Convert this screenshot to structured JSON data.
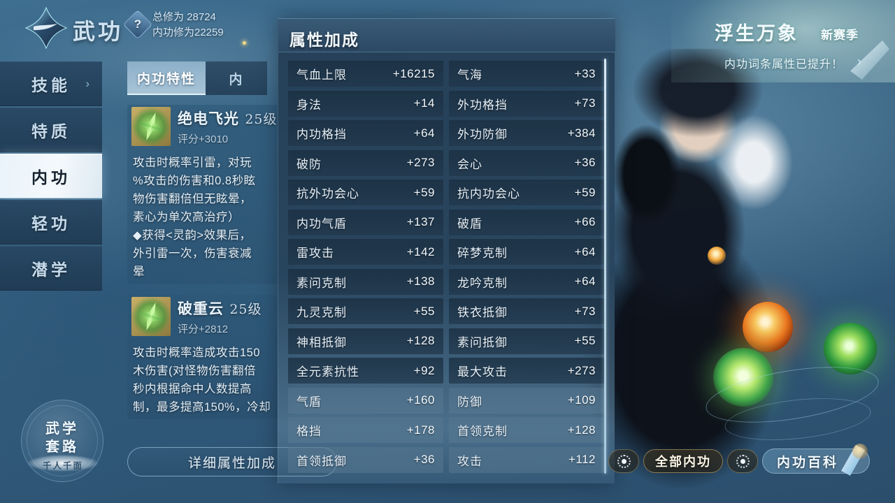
{
  "header": {
    "emblem_icon": "diamond-emblem-icon",
    "title": "武功",
    "help_icon": "question-mark-icon",
    "total_cultivation": "总修为 28724",
    "inner_cultivation": "内功修为22259"
  },
  "season_banner": {
    "title": "浮生万象",
    "badge": "新赛季",
    "subtitle": "内功词条属性已提升！",
    "arrow_icon": "chevron-right-icon",
    "feather_icon": "feather-icon"
  },
  "sidebar": {
    "items": [
      {
        "label": "技能",
        "active": false,
        "chevron": "›"
      },
      {
        "label": "特质",
        "active": false,
        "chevron": ""
      },
      {
        "label": "内功",
        "active": true,
        "chevron": ""
      },
      {
        "label": "轻功",
        "active": false,
        "chevron": ""
      },
      {
        "label": "潜学",
        "active": false,
        "chevron": ""
      }
    ]
  },
  "skill_panel": {
    "tabs": [
      {
        "label": "内功特性",
        "active": true
      },
      {
        "label": "内",
        "active": false
      }
    ],
    "cards": [
      {
        "icon": "wood-skill-icon",
        "name": "绝电飞光",
        "level": "25级",
        "score": "评分+3010",
        "description_lines": [
          "攻击时概率引雷，对玩",
          "%攻击的伤害和0.8秒眩",
          "物伤害翻倍但无眩晕，",
          "素心为单次高治疗）",
          "◆获得<灵韵>效果后，",
          "外引雷一次，伤害衰减",
          "晕"
        ]
      },
      {
        "icon": "wood-skill-icon",
        "name": "破重云",
        "level": "25级",
        "score": "评分+2812",
        "description_lines": [
          "攻击时概率造成攻击150",
          "木伤害(对怪物伤害翻倍",
          "秒内根据命中人数提高",
          "制，最多提高150%，冷却"
        ]
      }
    ],
    "detail_button": "详细属性加成"
  },
  "attribute_panel": {
    "title": "属性加成",
    "scrollbar": "vertical-scrollbar",
    "rows": [
      {
        "name": "气血上限",
        "value": "+16215",
        "dim": false
      },
      {
        "name": "气海",
        "value": "+33",
        "dim": false
      },
      {
        "name": "身法",
        "value": "+14",
        "dim": false
      },
      {
        "name": "外功格挡",
        "value": "+73",
        "dim": false
      },
      {
        "name": "内功格挡",
        "value": "+64",
        "dim": false
      },
      {
        "name": "外功防御",
        "value": "+384",
        "dim": false
      },
      {
        "name": "破防",
        "value": "+273",
        "dim": false
      },
      {
        "name": "会心",
        "value": "+36",
        "dim": false
      },
      {
        "name": "抗外功会心",
        "value": "+59",
        "dim": false
      },
      {
        "name": "抗内功会心",
        "value": "+59",
        "dim": false
      },
      {
        "name": "内功气盾",
        "value": "+137",
        "dim": false
      },
      {
        "name": "破盾",
        "value": "+66",
        "dim": false
      },
      {
        "name": "雷攻击",
        "value": "+142",
        "dim": false
      },
      {
        "name": "碎梦克制",
        "value": "+64",
        "dim": false
      },
      {
        "name": "素问克制",
        "value": "+138",
        "dim": false
      },
      {
        "name": "龙吟克制",
        "value": "+64",
        "dim": false
      },
      {
        "name": "九灵克制",
        "value": "+55",
        "dim": false
      },
      {
        "name": "铁衣抵御",
        "value": "+73",
        "dim": false
      },
      {
        "name": "神相抵御",
        "value": "+128",
        "dim": false
      },
      {
        "name": "素问抵御",
        "value": "+55",
        "dim": false
      },
      {
        "name": "全元素抗性",
        "value": "+92",
        "dim": false
      },
      {
        "name": "最大攻击",
        "value": "+273",
        "dim": false
      },
      {
        "name": "气盾",
        "value": "+160",
        "dim": true
      },
      {
        "name": "防御",
        "value": "+109",
        "dim": true
      },
      {
        "name": "格挡",
        "value": "+178",
        "dim": true
      },
      {
        "name": "首领克制",
        "value": "+128",
        "dim": true
      },
      {
        "name": "首领抵御",
        "value": "+36",
        "dim": true
      },
      {
        "name": "攻击",
        "value": "+112",
        "dim": true
      }
    ]
  },
  "bottom_left_badge": {
    "line1": "武学",
    "line2": "套路",
    "subtitle": "千人千面"
  },
  "bottom_bar": {
    "toggle_icon_left": "target-circle-icon",
    "all_neigong_label": "全部内功",
    "toggle_icon_right": "target-circle-icon",
    "encyclopedia_label": "内功百科",
    "scroll_icon": "scroll-icon"
  },
  "decor": {
    "orb_fire": "fire-orb-effect",
    "orb_wood": "wood-orb-effect",
    "orb_leaf": "leaf-orb-effect"
  },
  "colors": {
    "background": "#35607f",
    "panel": "#243e56",
    "accent_gold": "#e3c367",
    "active_tab": "#e9f3fa",
    "text_light": "#e6f0f8"
  }
}
